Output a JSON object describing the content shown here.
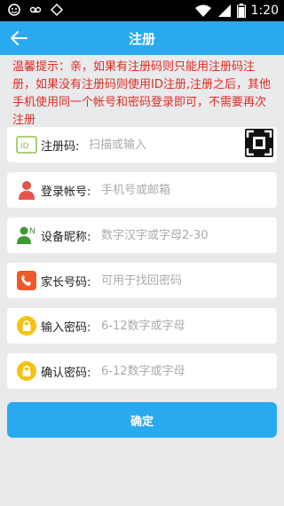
{
  "status_bar": {
    "time": "1:20"
  },
  "app_bar": {
    "title": "注册"
  },
  "notice": "温馨提示：亲，如果有注册码则只能用注册码注册，如果没有注册码则使用ID注册,注册之后，其他手机使用同一个帐号和密码登录即可，不需要再次注册",
  "fields": [
    {
      "label": "注册码:",
      "placeholder": "扫描或输入",
      "icon": "id-icon"
    },
    {
      "label": "登录帐号:",
      "placeholder": "手机号或邮箱",
      "icon": "user-icon"
    },
    {
      "label": "设备昵称:",
      "placeholder": "数字汉字或字母2-30",
      "icon": "device-nickname-icon"
    },
    {
      "label": "家长号码:",
      "placeholder": "可用于找回密码",
      "icon": "phone-icon"
    },
    {
      "label": "输入密码:",
      "placeholder": "6-12数字或字母",
      "icon": "lock-icon"
    },
    {
      "label": "确认密码:",
      "placeholder": "6-12数字或字母",
      "icon": "lock-icon"
    }
  ],
  "confirm_label": "确定",
  "colors": {
    "primary": "#29aaf0",
    "notice": "#e02b21",
    "user_icon": "#e5534b",
    "device_icon": "#3d9b2f",
    "phone_icon": "#f05a28",
    "lock_icon": "#f5c211",
    "id_icon": "#8bc34a"
  }
}
